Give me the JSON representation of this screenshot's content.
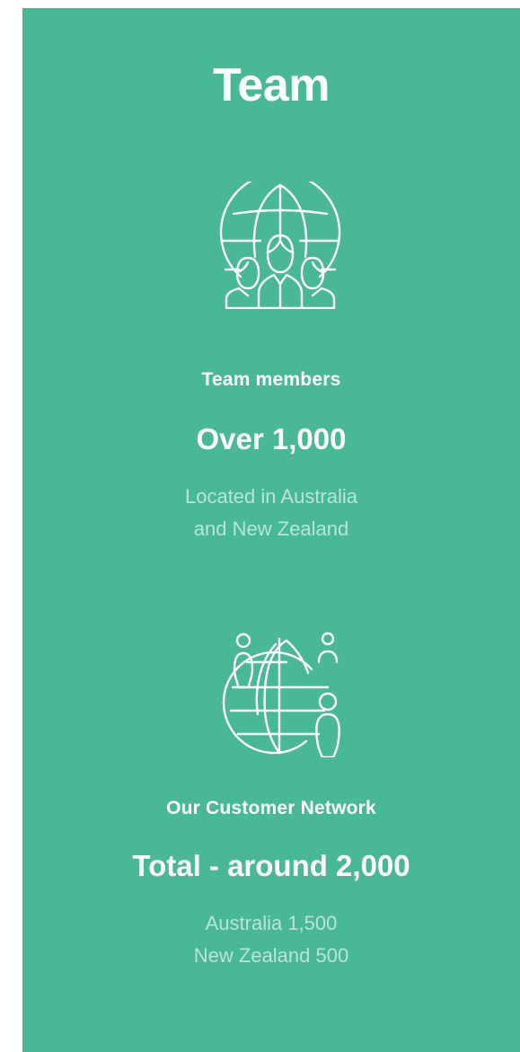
{
  "page": {
    "title": "Team",
    "background_color": "#48b896",
    "text_color": "#ffffff"
  },
  "team_section": {
    "icon": "globe-team-icon",
    "label": "Team members",
    "value": "Over 1,000",
    "description_line_1": "Located in Australia",
    "description_line_2": "and New Zealand"
  },
  "customer_section": {
    "icon": "globe-people-icon",
    "label": "Our Customer Network",
    "value": "Total - around 2,000",
    "description_line_1": "Australia 1,500",
    "description_line_2": "New Zealand 500"
  }
}
